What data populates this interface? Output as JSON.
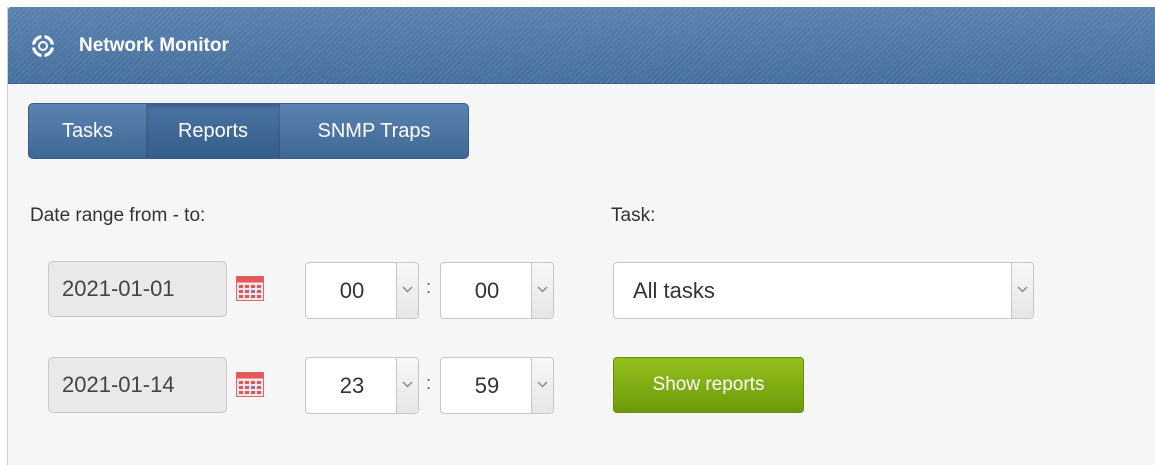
{
  "app": {
    "title": "Network Monitor"
  },
  "tabs": [
    {
      "label": "Tasks"
    },
    {
      "label": "Reports"
    },
    {
      "label": "SNMP Traps"
    }
  ],
  "form": {
    "date_range_label": "Date range from - to:",
    "task_label": "Task:",
    "from_date": "2021-01-01",
    "to_date": "2021-01-14",
    "from_hour": "00",
    "from_minute": "00",
    "to_hour": "23",
    "to_minute": "59",
    "time_separator": ":",
    "task_selected": "All tasks",
    "submit_label": "Show reports"
  },
  "icons": {
    "title": "lifebuoy-icon",
    "calendar": "calendar-icon",
    "dropdown": "chevron-down-icon"
  },
  "colors": {
    "header": "#4f77a4",
    "tabs": "#4a74a3",
    "submit": "#7fae12"
  }
}
